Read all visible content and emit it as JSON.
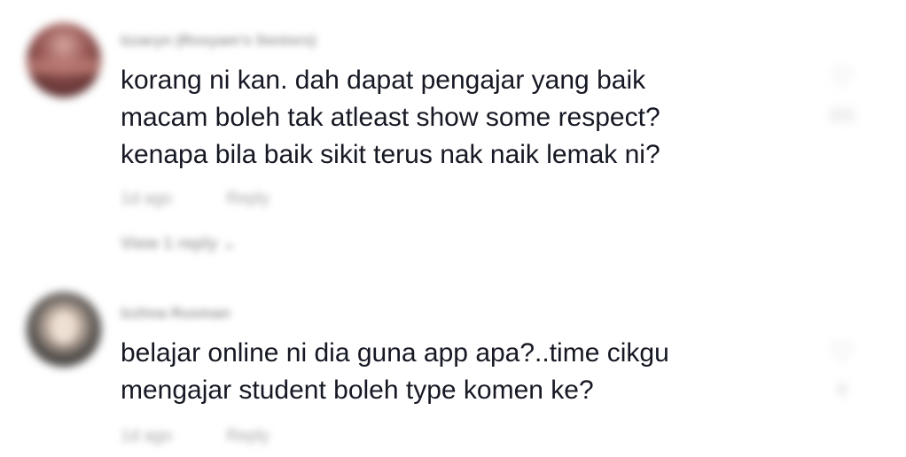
{
  "comments": [
    {
      "username": "Izzaryn (Rosyam's Seniors)",
      "text_lines": [
        "korang ni kan. dah dapat pengajar yang baik",
        "macam boleh tak atleast show some respect?",
        "kenapa bila baik sikit terus nak naik lemak ni?"
      ],
      "time": "1d ago",
      "reply_label": "Reply",
      "view_replies_label": "View 1 reply",
      "like_count": "221"
    },
    {
      "username": "Izzhna Rusman",
      "text_lines": [
        "belajar online ni dia guna app apa?..time cikgu",
        "mengajar student boleh type komen ke?"
      ],
      "time": "1d ago",
      "reply_label": "Reply",
      "like_count": "6"
    }
  ],
  "icons": {
    "like": "heart-outline-icon",
    "expand": "chevron-down-icon"
  },
  "colors": {
    "text": "#161823",
    "muted": "#a6a6a6",
    "background": "#ffffff"
  }
}
